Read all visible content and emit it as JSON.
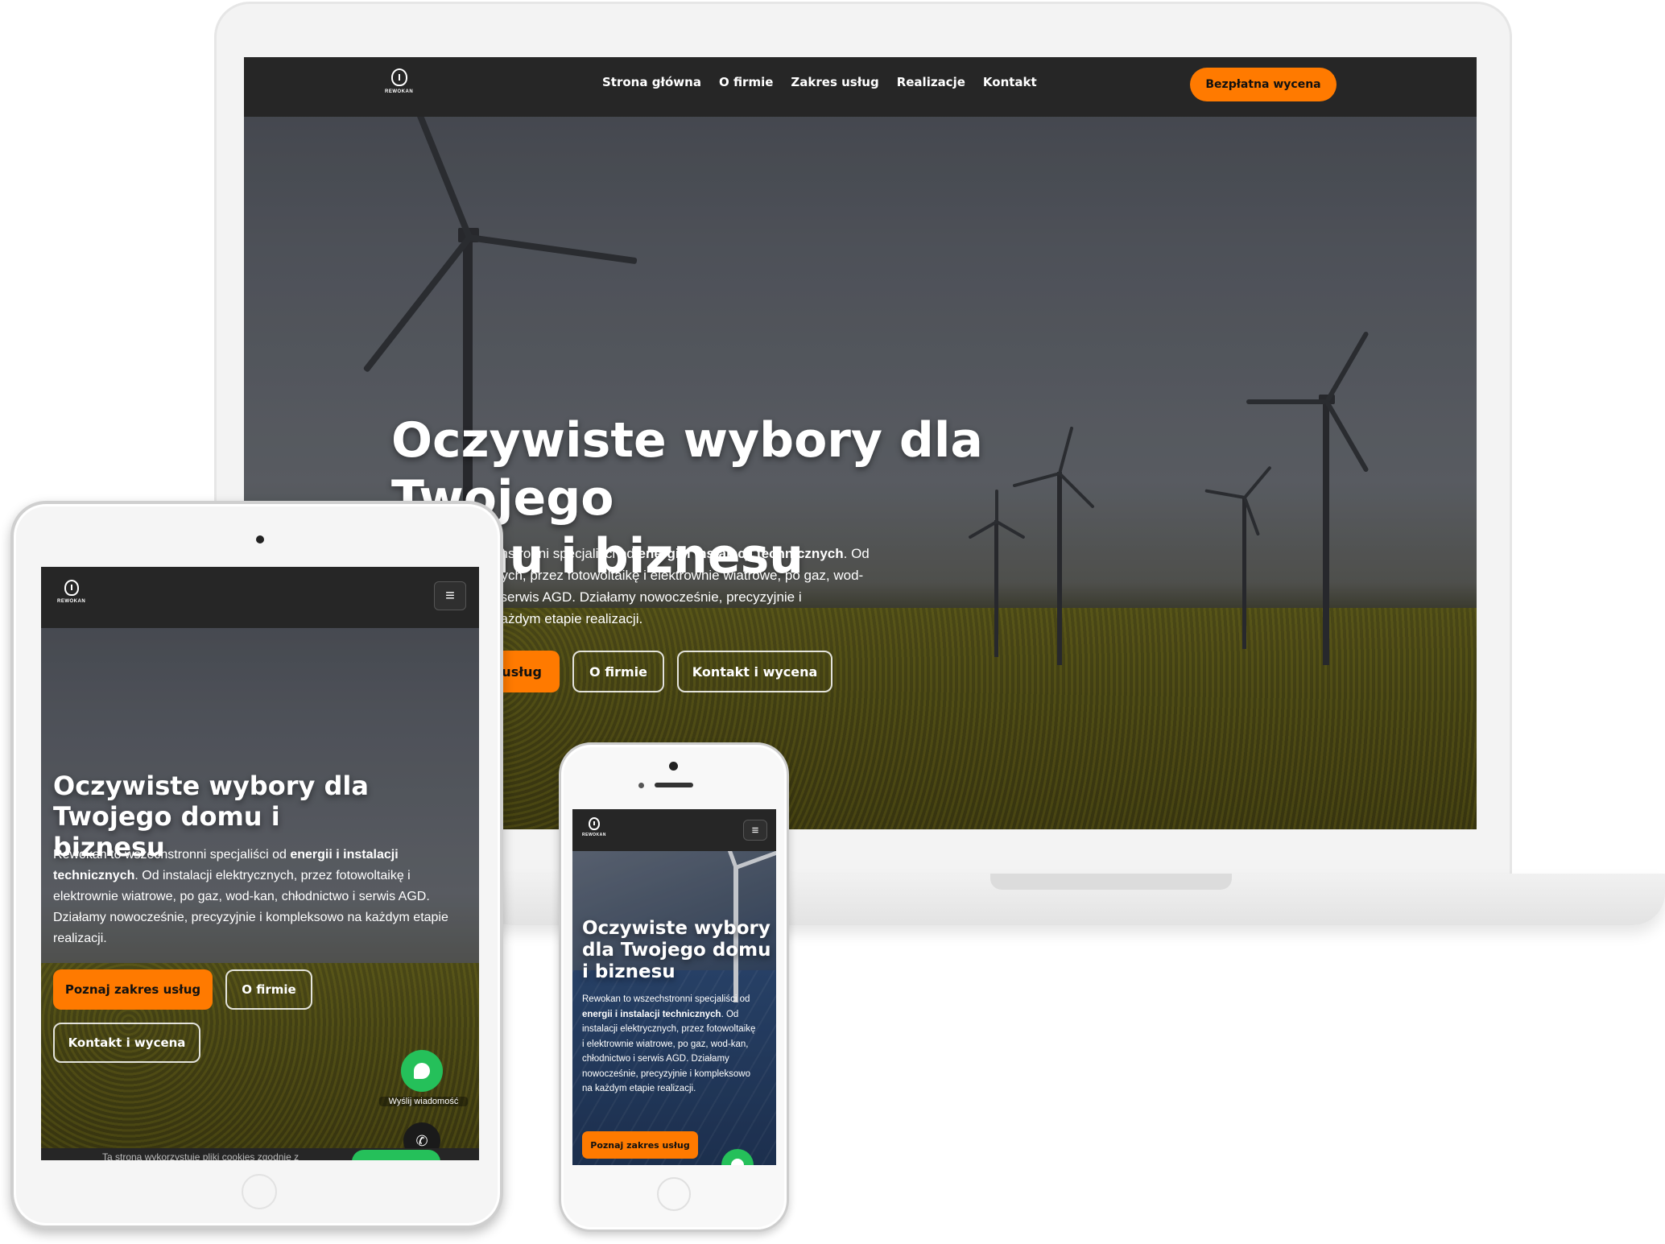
{
  "brand": {
    "logo_text": "REWOKAN",
    "accent_color": "#ff7a00",
    "header_bg": "#262626"
  },
  "desktop": {
    "nav": [
      "Strona główna",
      "O firmie",
      "Zakres usług",
      "Realizacje",
      "Kontakt"
    ],
    "cta": "Bezpłatna wycena",
    "headline_line1": "Oczywiste wybory dla Twojego",
    "headline_line2": "domu i biznesu",
    "lead_line1_pre": "chstronni specjaliści od ",
    "lead_line1_bold": "energii i instalacji technicznych",
    "lead_line1_post": ". Od",
    "lead_line2": "nych, przez fotowoltaikę i elektrownie wiatrowe, po gaz, wod-",
    "lead_line3": "i serwis AGD. Działamy nowocześnie, precyzyjnie i",
    "lead_line4": "każdym etapie realizacji.",
    "btn_services": "usług",
    "btn_about": "O firmie",
    "btn_contact": "Kontakt i wycena"
  },
  "tablet": {
    "headline": "Oczywiste wybory dla Twojego domu i biznesu",
    "lead_pre": "Rewokan to wszechstronni specjaliści od ",
    "lead_bold": "energii i instalacji technicznych",
    "lead_post": ". Od instalacji elektrycznych, przez fotowoltaikę i elektrownie wiatrowe, po gaz, wod-kan, chłodnictwo i serwis AGD. Działamy nowocześnie, precyzyjnie i kompleksowo na każdym etapie realizacji.",
    "btn_services": "Poznaj zakres usług",
    "btn_about": "O firmie",
    "btn_contact": "Kontakt i wycena",
    "chat_label": "Wyślij wiadomość",
    "cookie_text": "Ta strona wykorzystuje pliki cookies zgodnie z"
  },
  "phone": {
    "headline": "Oczywiste wybory dla Twojego domu i biznesu",
    "lead_pre": "Rewokan to wszechstronni specjaliści od ",
    "lead_bold": "energii i instalacji technicznych",
    "lead_post": ". Od instalacji elektrycznych, przez fotowoltaikę i elektrownie wiatrowe, po gaz, wod-kan, chłodnictwo i serwis AGD. Działamy nowocześnie, precyzyjnie i kompleksowo na każdym etapie realizacji.",
    "btn_services": "Poznaj zakres usług"
  }
}
